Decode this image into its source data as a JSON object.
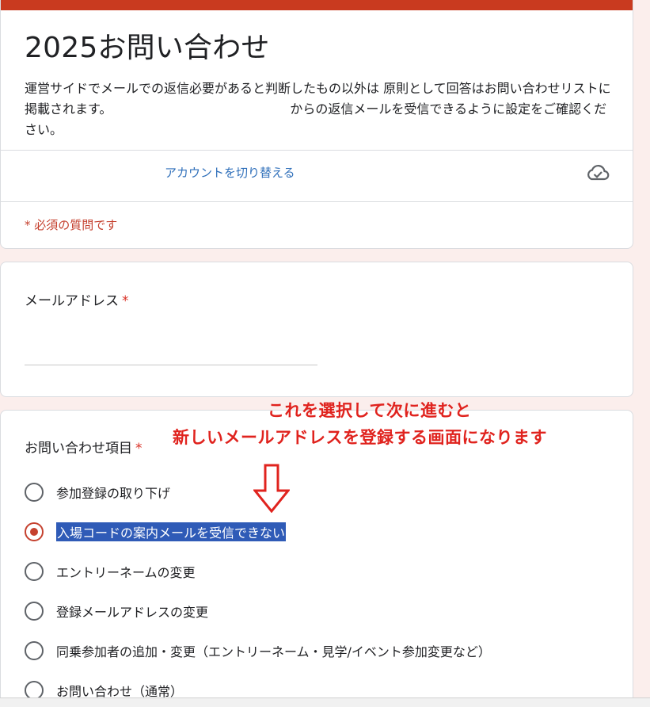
{
  "form": {
    "title": "2025お問い合わせ",
    "description_part1": "運営サイドでメールでの返信必要があると判断したもの以外は 原則として回答はお問い合わせリストに掲載されます。",
    "description_part2": "からの返信メールを受信できるように設定をご確認ください。",
    "switch_account": "アカウントを切り替える",
    "required_note": "* 必須の質問です"
  },
  "email_question": {
    "label": "メールアドレス",
    "required_mark": "*",
    "value": ""
  },
  "inquiry_question": {
    "label": "お問い合わせ項目",
    "required_mark": "*",
    "options": [
      {
        "label": "参加登録の取り下げ",
        "selected": false
      },
      {
        "label": "入場コードの案内メールを受信できない",
        "selected": true
      },
      {
        "label": "エントリーネームの変更",
        "selected": false
      },
      {
        "label": "登録メールアドレスの変更",
        "selected": false
      },
      {
        "label": "同乗参加者の追加・変更（エントリーネーム・見学/イベント参加変更など）",
        "selected": false
      },
      {
        "label": "お問い合わせ（通常）",
        "selected": false
      }
    ]
  },
  "annotation": {
    "line1": "これを選択して次に進むと",
    "line2": "新しいメールアドレスを登録する画面になります"
  },
  "colors": {
    "accent": "#c93a1f",
    "annotation": "#e0231e",
    "selection_highlight": "#2f5bb7"
  }
}
